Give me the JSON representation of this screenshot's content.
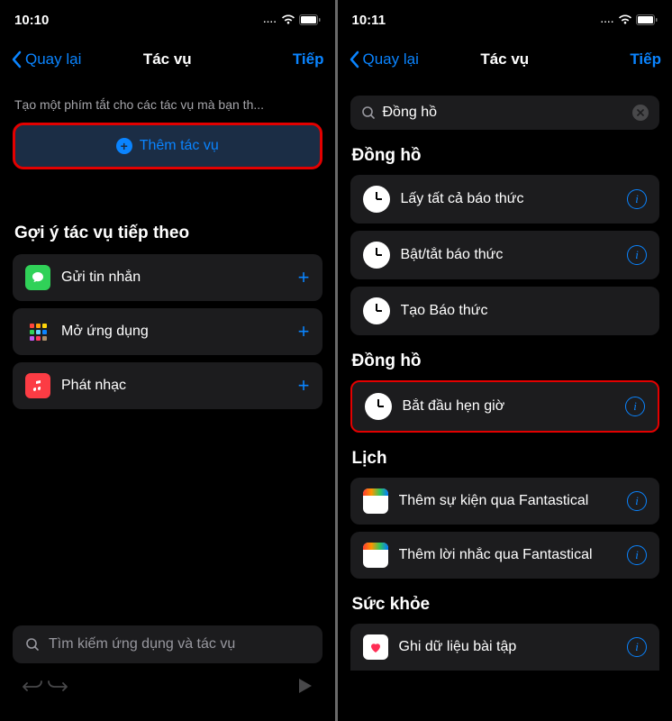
{
  "left": {
    "status_time": "10:10",
    "nav_back": "Quay lại",
    "nav_title": "Tác vụ",
    "nav_next": "Tiếp",
    "description": "Tạo một phím tắt cho các tác vụ mà bạn th...",
    "add_action_label": "Thêm tác vụ",
    "suggestions_header": "Gợi ý tác vụ tiếp theo",
    "suggestions": [
      {
        "label": "Gửi tin nhắn"
      },
      {
        "label": "Mở ứng dụng"
      },
      {
        "label": "Phát nhạc"
      }
    ],
    "search_placeholder": "Tìm kiếm ứng dụng và tác vụ"
  },
  "right": {
    "status_time": "10:11",
    "nav_back": "Quay lại",
    "nav_title": "Tác vụ",
    "nav_next": "Tiếp",
    "search_value": "Đồng hồ",
    "section_clock_1": "Đồng hồ",
    "clock_actions_1": [
      {
        "label": "Lấy tất cả báo thức"
      },
      {
        "label": "Bật/tắt báo thức"
      },
      {
        "label": "Tạo Báo thức"
      }
    ],
    "section_clock_2": "Đồng hồ",
    "clock_actions_2": [
      {
        "label": "Bắt đầu hẹn giờ"
      }
    ],
    "section_calendar": "Lịch",
    "calendar_actions": [
      {
        "label": "Thêm sự kiện qua Fantastical"
      },
      {
        "label": "Thêm lời nhắc qua Fantastical"
      }
    ],
    "section_health": "Sức khỏe",
    "health_actions": [
      {
        "label": "Ghi dữ liệu bài tập"
      }
    ]
  }
}
